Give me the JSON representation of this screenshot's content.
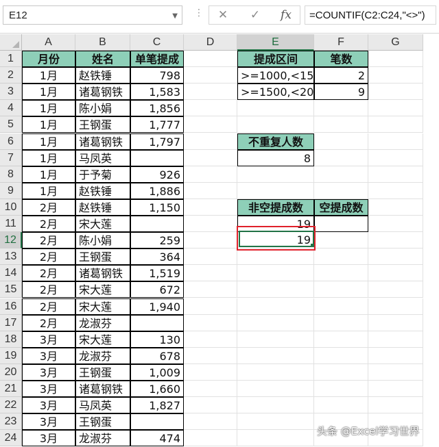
{
  "formula_bar": {
    "name_box": "E12",
    "formula": "=COUNTIF(C2:C24,\"<>\")",
    "cancel_glyph": "✕",
    "enter_glyph": "✓",
    "fx_glyph": "fx"
  },
  "columns": [
    "A",
    "B",
    "C",
    "D",
    "E",
    "F",
    "G"
  ],
  "rows": [
    "1",
    "2",
    "3",
    "4",
    "5",
    "6",
    "7",
    "8",
    "9",
    "10",
    "11",
    "12",
    "13",
    "14",
    "15",
    "16",
    "17",
    "18",
    "19",
    "20",
    "21",
    "22",
    "23",
    "24"
  ],
  "main_table": {
    "headers": [
      "月份",
      "姓名",
      "单笔提成"
    ],
    "rows": [
      [
        "1月",
        "赵铁锤",
        "798"
      ],
      [
        "1月",
        "诸葛钢铁",
        "1,583"
      ],
      [
        "1月",
        "陈小娟",
        "1,856"
      ],
      [
        "1月",
        "王钢蛋",
        "1,777"
      ],
      [
        "1月",
        "诸葛钢铁",
        "1,797"
      ],
      [
        "1月",
        "马凤英",
        ""
      ],
      [
        "1月",
        "于予菊",
        "926"
      ],
      [
        "1月",
        "赵铁锤",
        "1,886"
      ],
      [
        "2月",
        "赵铁锤",
        "1,150"
      ],
      [
        "2月",
        "宋大莲",
        ""
      ],
      [
        "2月",
        "陈小娟",
        "259"
      ],
      [
        "2月",
        "王钢蛋",
        "364"
      ],
      [
        "2月",
        "诸葛钢铁",
        "1,519"
      ],
      [
        "2月",
        "宋大莲",
        "672"
      ],
      [
        "2月",
        "宋大莲",
        "1,940"
      ],
      [
        "2月",
        "龙淑芬",
        ""
      ],
      [
        "3月",
        "宋大莲",
        "130"
      ],
      [
        "3月",
        "龙淑芬",
        "678"
      ],
      [
        "3月",
        "王钢蛋",
        "1,009"
      ],
      [
        "3月",
        "诸葛钢铁",
        "1,660"
      ],
      [
        "3月",
        "马凤英",
        "1,827"
      ],
      [
        "3月",
        "王钢蛋",
        ""
      ],
      [
        "3月",
        "龙淑芬",
        "474"
      ]
    ]
  },
  "range_table": {
    "headers": [
      "提成区间",
      "笔数"
    ],
    "rows": [
      [
        ">=1000,<1500",
        "2"
      ],
      [
        ">=1500,<2000",
        "9"
      ]
    ]
  },
  "unique_table": {
    "header": "不重复人数",
    "value": "8"
  },
  "blank_table": {
    "headers": [
      "非空提成数",
      "空提成数"
    ],
    "values": [
      "19",
      ""
    ],
    "e12_value": "19"
  },
  "watermark": "头条 @Excel学习世界",
  "colors": {
    "header_fill": "#8ecfb8",
    "selection_green": "#217346",
    "highlight_red": "#e0202a"
  }
}
